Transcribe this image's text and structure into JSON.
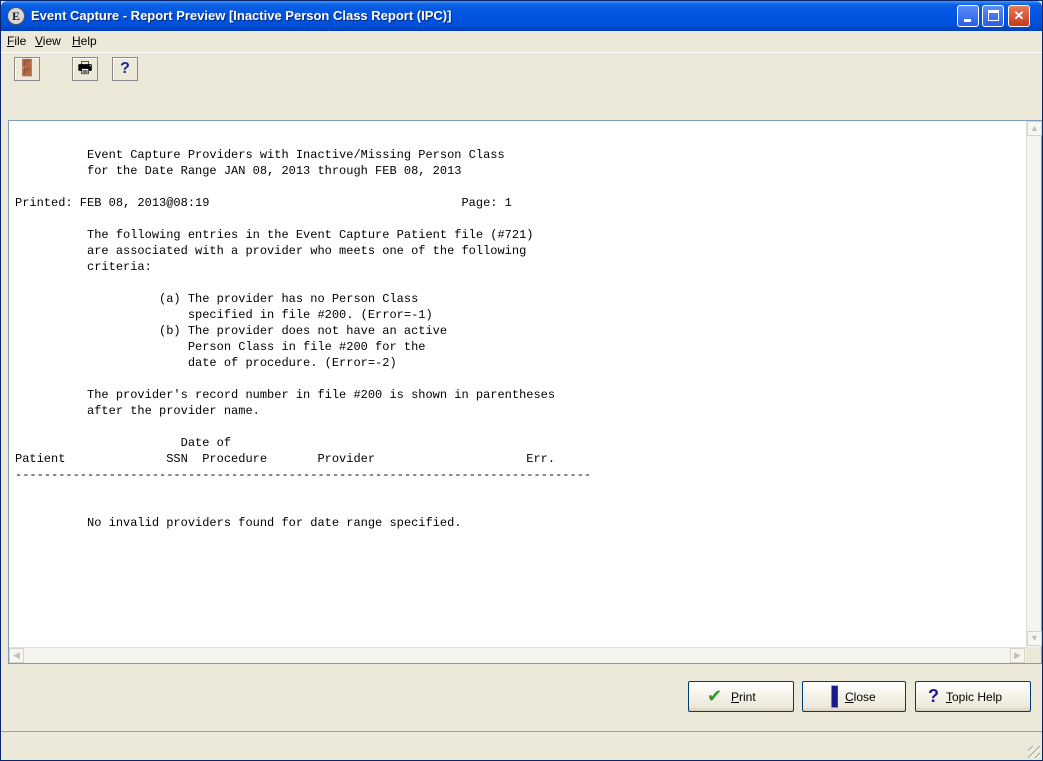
{
  "window": {
    "title": "Event Capture - Report Preview [Inactive Person Class Report (IPC)]",
    "app_icon_glyph": "E",
    "app_icon": "event-capture-app-icon",
    "controls": [
      "minimize",
      "maximize",
      "close"
    ]
  },
  "menu": {
    "items": [
      {
        "accel": "F",
        "rest": "ile"
      },
      {
        "accel": "V",
        "rest": "iew"
      },
      {
        "accel": "H",
        "rest": "elp"
      }
    ]
  },
  "toolbar": {
    "buttons": [
      {
        "icon": "exit-door-icon",
        "glyph": "🚪"
      },
      {
        "icon": "printer-icon",
        "glyph": "🖶"
      },
      {
        "icon": "help-question-icon",
        "glyph": "?"
      }
    ]
  },
  "report": {
    "lines": [
      "          Event Capture Providers with Inactive/Missing Person Class",
      "          for the Date Range JAN 08, 2013 through FEB 08, 2013",
      "",
      "Printed: FEB 08, 2013@08:19                                   Page: 1",
      "",
      "          The following entries in the Event Capture Patient file (#721)",
      "          are associated with a provider who meets one of the following",
      "          criteria:",
      "",
      "                    (a) The provider has no Person Class",
      "                        specified in file #200. (Error=-1)",
      "                    (b) The provider does not have an active",
      "                        Person Class in file #200 for the",
      "                        date of procedure. (Error=-2)",
      "",
      "          The provider's record number in file #200 is shown in parentheses",
      "          after the provider name.",
      "",
      "                       Date of",
      "Patient              SSN  Procedure       Provider                     Err.",
      "--------------------------------------------------------------------------------",
      "",
      "",
      "          No invalid providers found for date range specified."
    ]
  },
  "buttons": {
    "print": {
      "accel": "P",
      "rest": "rint",
      "icon": "checkmark-icon",
      "glyph": "✔",
      "color": "#2a9d2a"
    },
    "close": {
      "accel": "C",
      "rest": "lose",
      "icon": "door-exit-icon",
      "glyph": "▐",
      "color": "#1a1a8a"
    },
    "topic_help": {
      "accel": "T",
      "rest": "opic Help",
      "icon": "help-question-icon",
      "glyph": "?",
      "color": "#1a1a8a"
    }
  },
  "colors": {
    "titlebar": "#0054e3",
    "window_face": "#ece9d8",
    "report_bg": "#ffffff"
  }
}
